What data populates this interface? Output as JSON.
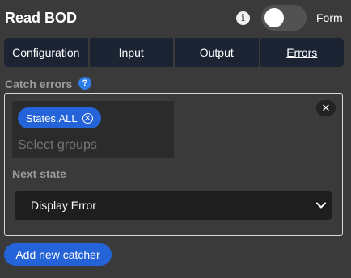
{
  "header": {
    "title": "Read BOD",
    "info_icon_glyph": "i",
    "form_label": "Form",
    "form_toggle_on": false
  },
  "tabs": [
    {
      "label": "Configuration",
      "active": false
    },
    {
      "label": "Input",
      "active": false
    },
    {
      "label": "Output",
      "active": false
    },
    {
      "label": "Errors",
      "active": true
    }
  ],
  "catch_errors": {
    "label": "Catch errors",
    "help_glyph": "?",
    "catchers": [
      {
        "groups": [
          "States.ALL"
        ],
        "groups_placeholder": "Select groups",
        "remove_glyph": "✕",
        "next_state_label": "Next state",
        "next_state_value": "Display Error"
      }
    ],
    "add_button_label": "Add new catcher"
  },
  "colors": {
    "background": "#3a3a3a",
    "tab_background": "#1c2333",
    "accent_blue": "#2563d9",
    "help_blue": "#2f7de8"
  },
  "icons": [
    "info-icon",
    "help-icon",
    "chip-remove-icon",
    "remove-catcher-icon",
    "chevron-down-icon"
  ]
}
